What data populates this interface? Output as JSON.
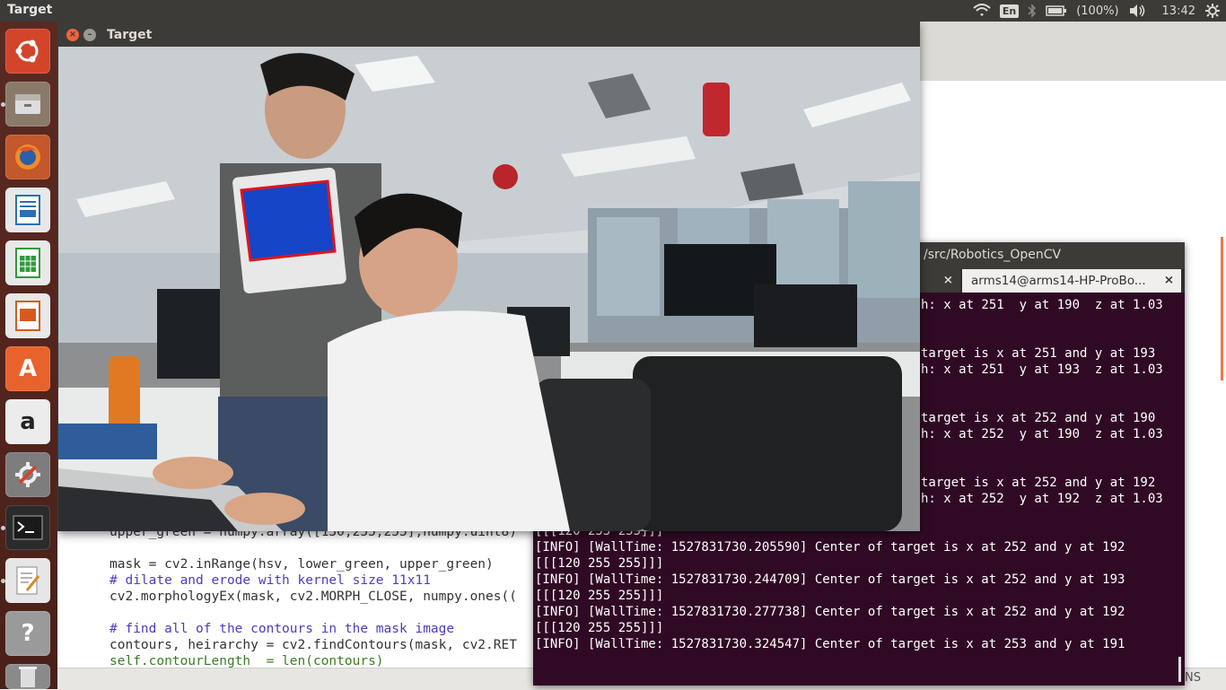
{
  "topbar": {
    "app_title": "Target",
    "language": "En",
    "battery": "(100%)",
    "time": "13:42",
    "icons": [
      "wifi-icon",
      "bluetooth-icon",
      "battery-icon",
      "volume-icon",
      "settings-icon"
    ]
  },
  "launcher": {
    "items": [
      "ubuntu-dash",
      "files",
      "firefox",
      "libreoffice-writer",
      "libreoffice-calc",
      "libreoffice-impress",
      "software-center",
      "amazon",
      "system-settings",
      "terminal",
      "text-editor",
      "help",
      "trash"
    ]
  },
  "image_window": {
    "title": "Target",
    "close_label": "×",
    "min_label": "–"
  },
  "terminal": {
    "title_path": "/src/Robotics_OpenCV",
    "tabs": [
      {
        "label": "",
        "close": "×"
      },
      {
        "label": "arms14@arms14-HP-ProBo...",
        "close": "×"
      }
    ],
    "lines": [
      "h: x at 251  y at 190  z at 1.03",
      "",
      "",
      "target is x at 251 and y at 193",
      "h: x at 251  y at 193  z at 1.03",
      "",
      "",
      "target is x at 252 and y at 190",
      "h: x at 252  y at 190  z at 1.03",
      "",
      "",
      "target is x at 252 and y at 192",
      "h: x at 252  y at 192  z at 1.03",
      "",
      "[[[120 255 255]]]",
      "[INFO] [WallTime: 1527831730.205590] Center of target is x at 252 and y at 192",
      "[[[120 255 255]]]",
      "[INFO] [WallTime: 1527831730.244709] Center of target is x at 252 and y at 193",
      "[[[120 255 255]]]",
      "[INFO] [WallTime: 1527831730.277738] Center of target is x at 252 and y at 192",
      "[[[120 255 255]]]",
      "[INFO] [WallTime: 1527831730.324547] Center of target is x at 253 and y at 191"
    ]
  },
  "editor": {
    "code_lines": [
      {
        "text": "upper_green = numpy.array([130,255,255],numpy.uint8)",
        "kind": "plain"
      },
      {
        "text": "",
        "kind": "plain"
      },
      {
        "text": "mask = cv2.inRange(hsv, lower_green, upper_green)",
        "kind": "plain"
      },
      {
        "text": "# dilate and erode with kernel size 11x11",
        "kind": "cm"
      },
      {
        "text": "cv2.morphologyEx(mask, cv2.MORPH_CLOSE, numpy.ones((",
        "kind": "plain"
      },
      {
        "text": "",
        "kind": "plain"
      },
      {
        "text": "# find all of the contours in the mask image",
        "kind": "cm"
      },
      {
        "text": "contours, heirarchy = cv2.findContours(mask, cv2.RET",
        "kind": "plain"
      },
      {
        "text": "self.contourLength  = len(contours)",
        "kind": "kw"
      }
    ],
    "status_right": "NS"
  }
}
